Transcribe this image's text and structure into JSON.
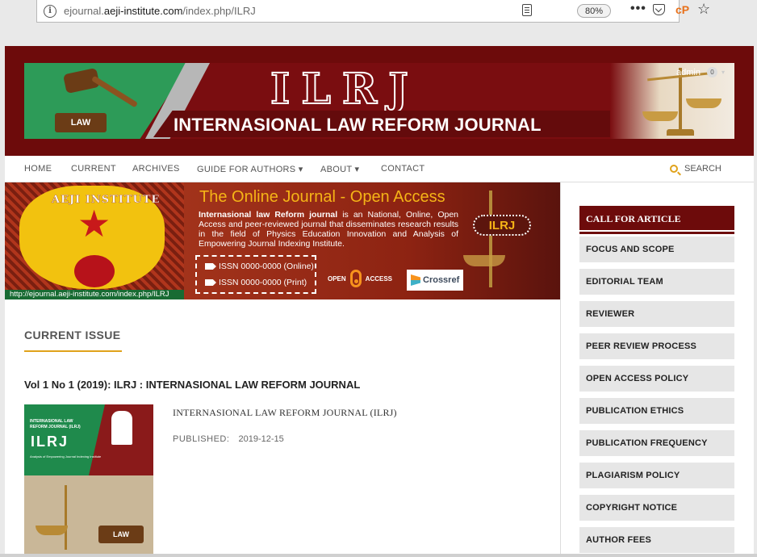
{
  "browser": {
    "url_prefix": "ejournal.",
    "url_domain": "aeji-institute.com",
    "url_path": "/index.php/ILRJ",
    "info_glyph": "i",
    "zoom": "80%",
    "menu_glyph": "•••",
    "extension_label": "cP",
    "star_glyph": "☆"
  },
  "header": {
    "logo_text": "ILRJ",
    "journal_title": "INTERNASIONAL LAW REFORM JOURNAL",
    "law_block": "LAW",
    "user_name": "admin",
    "user_badge": "0",
    "user_caret": "▾"
  },
  "nav": {
    "items": [
      {
        "label": "HOME"
      },
      {
        "label": "CURRENT"
      },
      {
        "label": "ARCHIVES"
      },
      {
        "label": "GUIDE FOR AUTHORS ▾"
      },
      {
        "label": "ABOUT ▾"
      },
      {
        "label": "CONTACT"
      }
    ],
    "search_label": "SEARCH"
  },
  "promo": {
    "emblem_text": "AEJI INSTITUTE",
    "emblem_star": "★",
    "url_strip": "http://ejournal.aeji-institute.com/index.php/ILRJ",
    "headline": "The Online Journal - Open Access",
    "desc_bold": "Internasional law Reform journal",
    "desc_rest": " is an National, Online, Open Access and peer-reviewed journal that disseminates research results in the field of Physics Education Innovation and Analysis of Empowering Journal Indexing Institute.",
    "issn_online": "ISSN 0000-0000 (Online)",
    "issn_print": "ISSN 0000-0000 (Print)",
    "badge": "ILRJ",
    "open_label": "OPEN",
    "access_label": "ACCESS",
    "crossref_label": "Crossref"
  },
  "main": {
    "section_title": "CURRENT ISSUE",
    "issue_title": "Vol 1 No 1 (2019): ILRJ : INTERNASIONAL LAW REFORM JOURNAL",
    "cover": {
      "line1": "INTERNASIONAL LAW",
      "line2": "REFORM JOURNAL (ILRJ)",
      "abbr": "ILRJ",
      "sub": "Analysis of Empowering Journal Indexing Institute",
      "law": "LAW"
    },
    "issue_description": "INTERNASIONAL LAW REFORM JOURNAL (ILRJ)",
    "published_label": "PUBLISHED:",
    "published_date": "2019-12-15"
  },
  "sidebar": {
    "heading": "CALL FOR ARTICLE",
    "items": [
      {
        "label": "FOCUS AND SCOPE"
      },
      {
        "label": "EDITORIAL TEAM"
      },
      {
        "label": "REVIEWER"
      },
      {
        "label": "PEER REVIEW PROCESS"
      },
      {
        "label": "OPEN ACCESS POLICY"
      },
      {
        "label": "PUBLICATION ETHICS"
      },
      {
        "label": "PUBLICATION FREQUENCY"
      },
      {
        "label": "PLAGIARISM POLICY"
      },
      {
        "label": "COPYRIGHT NOTICE"
      },
      {
        "label": "AUTHOR FEES"
      }
    ]
  },
  "colors": {
    "brand_maroon": "#6d0b0b",
    "accent_gold": "#e0a21b",
    "promo_headline": "#f5b417"
  }
}
